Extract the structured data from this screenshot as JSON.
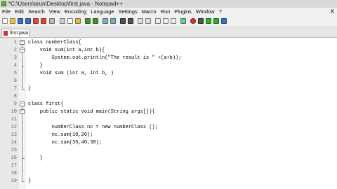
{
  "window": {
    "title": "*C:\\Users\\arun\\Desktop\\first.java - Notepad++"
  },
  "menubar": [
    "File",
    "Edit",
    "Search",
    "View",
    "Encoding",
    "Language",
    "Settings",
    "Macro",
    "Run",
    "Plugins",
    "Window",
    "?"
  ],
  "menubar_close": "X",
  "toolbar": {
    "icons": [
      "new-file-icon",
      "open-file-icon",
      "save-icon",
      "save-all-icon",
      "close-icon",
      "close-all-icon",
      "print-icon",
      "cut-icon",
      "copy-icon",
      "paste-icon",
      "undo-icon",
      "redo-icon",
      "find-icon",
      "replace-icon",
      "zoom-in-icon",
      "zoom-out-icon",
      "sync-vertical-icon",
      "sync-horizontal-icon",
      "word-wrap-icon",
      "show-all-characters-icon",
      "indent-guide-icon",
      "user-defined-language-icon",
      "record-macro-icon",
      "stop-recording-icon",
      "playback-icon",
      "run-macro-multiple-icon",
      "save-macro-icon"
    ]
  },
  "tabs": [
    {
      "label": "first.java"
    }
  ],
  "editor": {
    "lines": [
      {
        "num": "1",
        "text": "class numberClass{"
      },
      {
        "num": "2",
        "text": "    void sum(int a,int b){"
      },
      {
        "num": "3",
        "text": "        System.out.println(\"The result is \" +(a+b));"
      },
      {
        "num": "4",
        "text": "    }"
      },
      {
        "num": "5",
        "text": "    void sum (int a, int b, )"
      },
      {
        "num": "6",
        "text": ""
      },
      {
        "num": "7",
        "text": "}"
      },
      {
        "num": "8",
        "text": ""
      },
      {
        "num": "9",
        "text": "class first{"
      },
      {
        "num": "10",
        "text": "    public static void main(String args[]){"
      },
      {
        "num": "11",
        "text": ""
      },
      {
        "num": "12",
        "text": "        numberClass nc = new numberClass ();"
      },
      {
        "num": "13",
        "text": "        nc.sum(10,20);"
      },
      {
        "num": "14",
        "text": "        nc.sum(35,40,30);"
      },
      {
        "num": "15",
        "text": ""
      },
      {
        "num": "16",
        "text": "    }"
      },
      {
        "num": "17",
        "text": ""
      },
      {
        "num": "18",
        "text": ""
      },
      {
        "num": "19",
        "text": "}"
      }
    ]
  }
}
